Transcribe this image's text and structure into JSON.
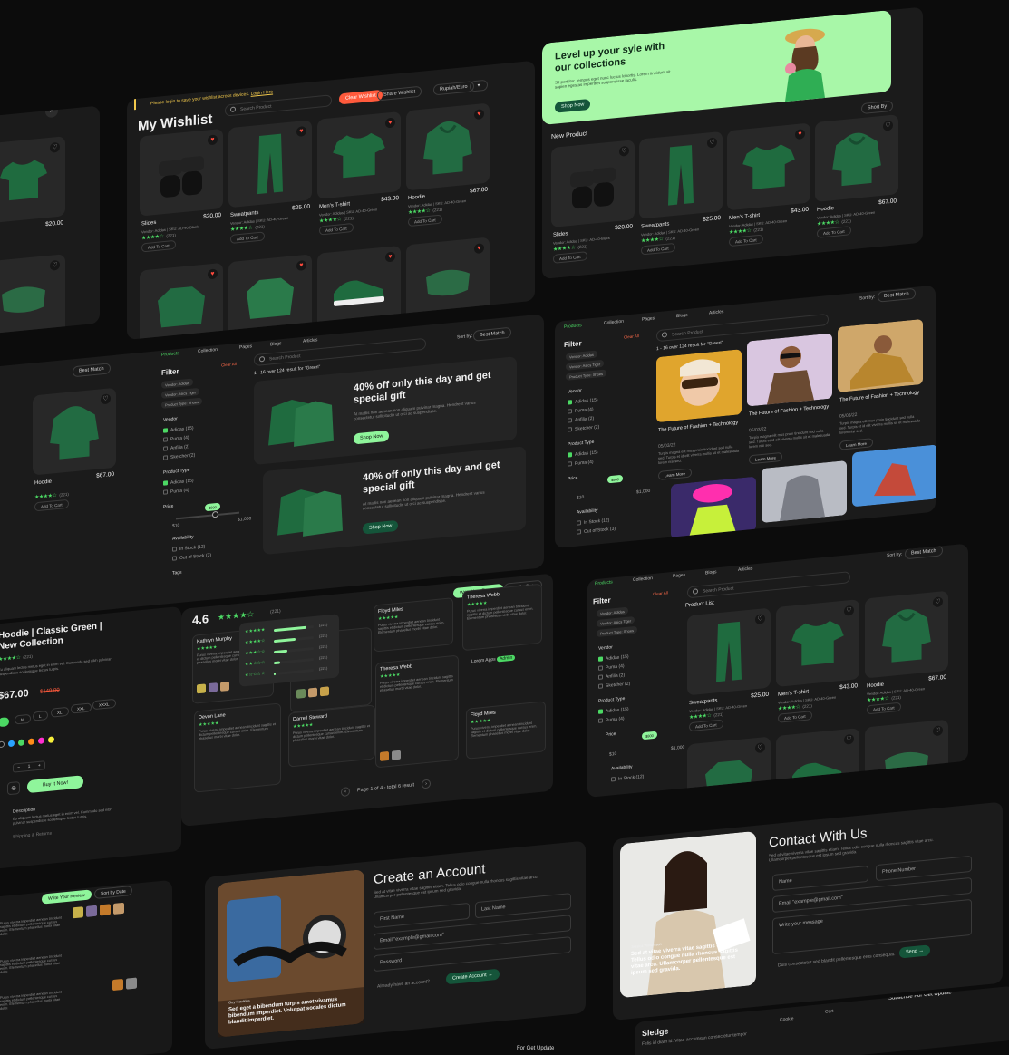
{
  "wishlist": {
    "banner_text": "Please login to save your wishlist across devices.",
    "banner_link": "Login Here",
    "title": "My Wishlist",
    "search_placeholder": "Search Product",
    "clear_label": "Clear Wishlist",
    "share_label": "Share Wishlist",
    "currency": "Rupiah/Euro",
    "products": [
      {
        "name": "Slides",
        "price": "$20.00",
        "meta": "Vendor: Adidas | SKU: AD-40-Black",
        "reviews": "(221)",
        "favorite": true
      },
      {
        "name": "Sweatpants",
        "price": "$25.00",
        "meta": "Vendor: Adidas | SKU: AD-40-Green",
        "reviews": "(221)",
        "favorite": true
      },
      {
        "name": "Men's T-shirt",
        "price": "$43.00",
        "meta": "Vendor: Adidas | SKU: AD-40-Green",
        "reviews": "(221)",
        "favorite": true
      },
      {
        "name": "Hoodie",
        "price": "$67.00",
        "meta": "Vendor: Adidas | SKU: AD-40-Green",
        "reviews": "(221)",
        "favorite": true
      }
    ],
    "add_to_cart": "Add To Cart"
  },
  "hero": {
    "title": "Level up your syle with our collections",
    "text": "Sit porttitor, tempus eget nunc luctus lobortis. Lorem tincidunt sit sapien egestas imperdiet suspendisse iaculis.",
    "button": "Shop Now",
    "section": "New Product",
    "sort": "Short By",
    "colors": {
      "banner": "#a8f7a8",
      "accent": "#4cd964"
    }
  },
  "new_products": [
    {
      "name": "Slides",
      "price": "$20.00",
      "meta": "Vendor: Adidas | SKU: AD-40-Black",
      "reviews": "(221)"
    },
    {
      "name": "Sweatpants",
      "price": "$25.00",
      "meta": "Vendor: Adidas | SKU: AD-40-Green",
      "reviews": "(221)"
    },
    {
      "name": "Men's T-shirt",
      "price": "$43.00",
      "meta": "Vendor: Adidas | SKU: AD-40-Green",
      "reviews": "(221)"
    },
    {
      "name": "Hoodie",
      "price": "$67.00",
      "meta": "Vendor: Adidas | SKU: AD-40-Green",
      "reviews": "(221)"
    }
  ],
  "search_page": {
    "tabs": [
      "Products",
      "Collection",
      "Pages",
      "Blogs",
      "Articles"
    ],
    "products_count": "2",
    "sort_by": "Sort by:",
    "best_match": "Best Match",
    "search_placeholder": "Search Product",
    "filter": "Filter",
    "clear_all": "Clear All",
    "result_text": "1 - 16 over 124 result for \"Green\"",
    "chips": [
      "Vendor: Adidas",
      "Vendor: Asics Tiger",
      "Product Type: Shoes"
    ],
    "vendor_label": "Vendor",
    "vendors": [
      "Adidas (15)",
      "Puma (4)",
      "Anfilia (2)",
      "Sketcher (2)"
    ],
    "product_type_label": "Product Type",
    "product_types": [
      "Adidas (15)",
      "Puma (4)"
    ],
    "price_label": "Price",
    "price_value": "$800",
    "price_min": "$10",
    "price_max": "$1,000",
    "availability_label": "Availability",
    "availability": [
      "In Stock (12)",
      "Out of Stock (3)"
    ],
    "tags_label": "Tags",
    "promo_title": "40% off only this day and get special gift",
    "promo_text": "At mattis non aenean non aliquam pulvinar magna. Hendrerit varius consectetur sollicitudin ut orci ac suspendisse.",
    "promo_button": "Shop Now",
    "articles": [
      {
        "title": "The Future of Fashion + Technology",
        "date": "05/03/22",
        "text": "Turpis magna elit mus proin tincidunt sed nulla sed. Turpis et id elit viverra mollis sit et malesuada lorem nisi sed.",
        "button": "Learn More"
      },
      {
        "title": "The Future of Fashion + Technology",
        "date": "05/03/22",
        "text": "Turpis magna elit mus proin tincidunt sed nulla sed. Turpis et id elit viverra mollis sit et malesuada lorem nisi sed.",
        "button": "Learn More"
      },
      {
        "title": "The Future of Fashion + Technology",
        "date": "05/03/22",
        "text": "Turpis magna elit mus proin tincidunt sed nulla sed. Turpis et id elit viverra mollis sit et malesuada lorem nisi sed.",
        "button": "Learn More"
      }
    ],
    "product_list": "Product List"
  },
  "product_detail": {
    "title": "Hoodie | Classic Green | New Collection",
    "reviews": "(221)",
    "price": "$67.00",
    "old_price": "$149.00",
    "sizes": [
      "S",
      "M",
      "L",
      "XL",
      "XXL",
      "XXXL"
    ],
    "buy": "Buy It Now!",
    "description": "Description",
    "description_text": "Eu aliquam lectus metus eget in enim vel. Commodo sed nibh pulvinar suspendisse scelerisque lectus turpis.",
    "shipping": "Shipping & Returns",
    "qty": "1"
  },
  "reviews": {
    "score": "4.6",
    "count": "(221)",
    "write_review": "Write Your Review",
    "sort_by_date": "Sort by Date",
    "distribution": [
      0.82,
      0.55,
      0.35,
      0.15,
      0.05
    ],
    "distribution_labels": [
      "(221)",
      "(221)",
      "(221)",
      "(221)",
      "(221)"
    ],
    "reviewers": [
      {
        "name": "Kathryn Murphy",
        "date": "05/03/22"
      },
      {
        "name": "Floyd Miles",
        "date": "05/03/22"
      },
      {
        "name": "Theresa Webb",
        "date": "05/03/22"
      },
      {
        "name": "Devon Lane",
        "date": "05/03/22"
      },
      {
        "name": "Darrell Steward",
        "date": "05/03/22"
      },
      {
        "name": "Theresa Webb",
        "date": "05/03/22"
      },
      {
        "name": "Floyd Miles",
        "date": "05/03/22"
      }
    ],
    "reply_name": "Lorem Apps",
    "reply_badge": "Admin",
    "pagination": "Page 1 of 4 - total 6 result",
    "review_text": "Purus viverra imperdiet aenean tincidunt sagittis et dictum pellentesque cursus enim. Elementum phasellus morbi vitae dolor."
  },
  "create_account": {
    "title": "Create an Account",
    "text": "Sed at vitae viverra vitae sagittis etiam. Tellus odio congue nulla rhoncus sagittis vitae arcu. Ullamcorper pellentesque est ipsum sed gravida.",
    "first_name": "First Name",
    "last_name": "Last Name",
    "email": "Email \"example@gmail.com\"",
    "password": "Password",
    "have_account": "Already have an account?",
    "button": "Create Account",
    "quote_author": "Guy Hawkins",
    "quote": "Sed eget a bibendum turpis amet vivamus bibendum imperdiet. Volutpat sodales dictum blandit imperdiet."
  },
  "contact": {
    "title": "Contact With Us",
    "text": "Sed at vitae viverra vitae sagittis etiam. Tellus odio congue nulla rhoncus sagittis vitae arcu. Ullamcorper pellentesque est ipsum sed gravida.",
    "name": "Name",
    "phone": "Phone Number",
    "email": "Email \"example@gmail.com\"",
    "message": "Write your message",
    "note": "Duis consectetur sed blandit pellentesque eros consequat.",
    "button": "Send",
    "quote_author": "Jessica Williamson",
    "quote": "Sed at vitae viverra vitae sagittis etiam. Tellus odio congue nulla rhoncus sagittis vitae arcu. Ullamcorper pellentesque est ipsum sed gravida."
  },
  "footer": {
    "brand": "Sledge",
    "tagline": "Felis id diam id. Vitae accumsan consectetur tempor",
    "col1": "Cookie",
    "col2": "Cart",
    "subscribe": "Subscribe For Get Update",
    "get_update": "For Get Update"
  }
}
